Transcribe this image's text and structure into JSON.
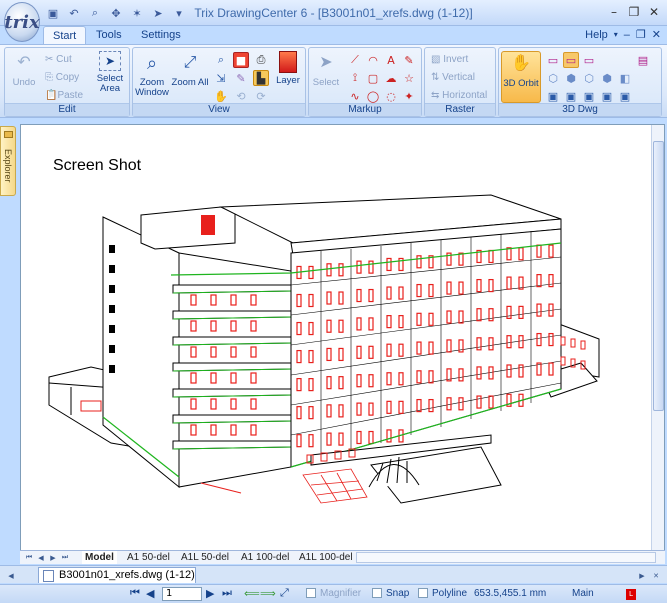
{
  "app": {
    "title": "Trix DrawingCenter 6 - [B3001n01_xrefs.dwg (1-12)]",
    "logo_text": "trix"
  },
  "ribbon_tabs": [
    "Start",
    "Tools",
    "Settings"
  ],
  "help_label": "Help",
  "groups": {
    "edit": {
      "label": "Edit",
      "undo": "Undo",
      "cut": "Cut",
      "copy": "Copy",
      "paste": "Paste",
      "select_area": "Select Area"
    },
    "view": {
      "label": "View",
      "zoom_window": "Zoom Window",
      "zoom_all": "Zoom All",
      "layer": "Layer"
    },
    "markup": {
      "label": "Markup",
      "select": "Select"
    },
    "raster": {
      "label": "Raster",
      "invert": "Invert",
      "vertical": "Vertical",
      "horizontal": "Horizontal"
    },
    "dwg3d": {
      "label": "3D Dwg",
      "orbit": "3D Orbit"
    }
  },
  "explorer_label": "Explorer",
  "canvas": {
    "caption": "Screen Shot"
  },
  "sheet_tabs": [
    "Model",
    "A1 50-del",
    "A1L 50-del",
    "A1 100-del",
    "A1L 100-del"
  ],
  "document_tab": "B3001n01_xrefs.dwg (1-12)",
  "status": {
    "page": "1",
    "magnifier": "Magnifier",
    "snap": "Snap",
    "polyline": "Polyline",
    "coords": "653.5,455.1 mm",
    "layer": "Main"
  },
  "colors": {
    "accent": "#15428b",
    "ribbon_bg": "#dbe8fa",
    "window_red": "#e8201c",
    "outline_green": "#1fb51f"
  }
}
